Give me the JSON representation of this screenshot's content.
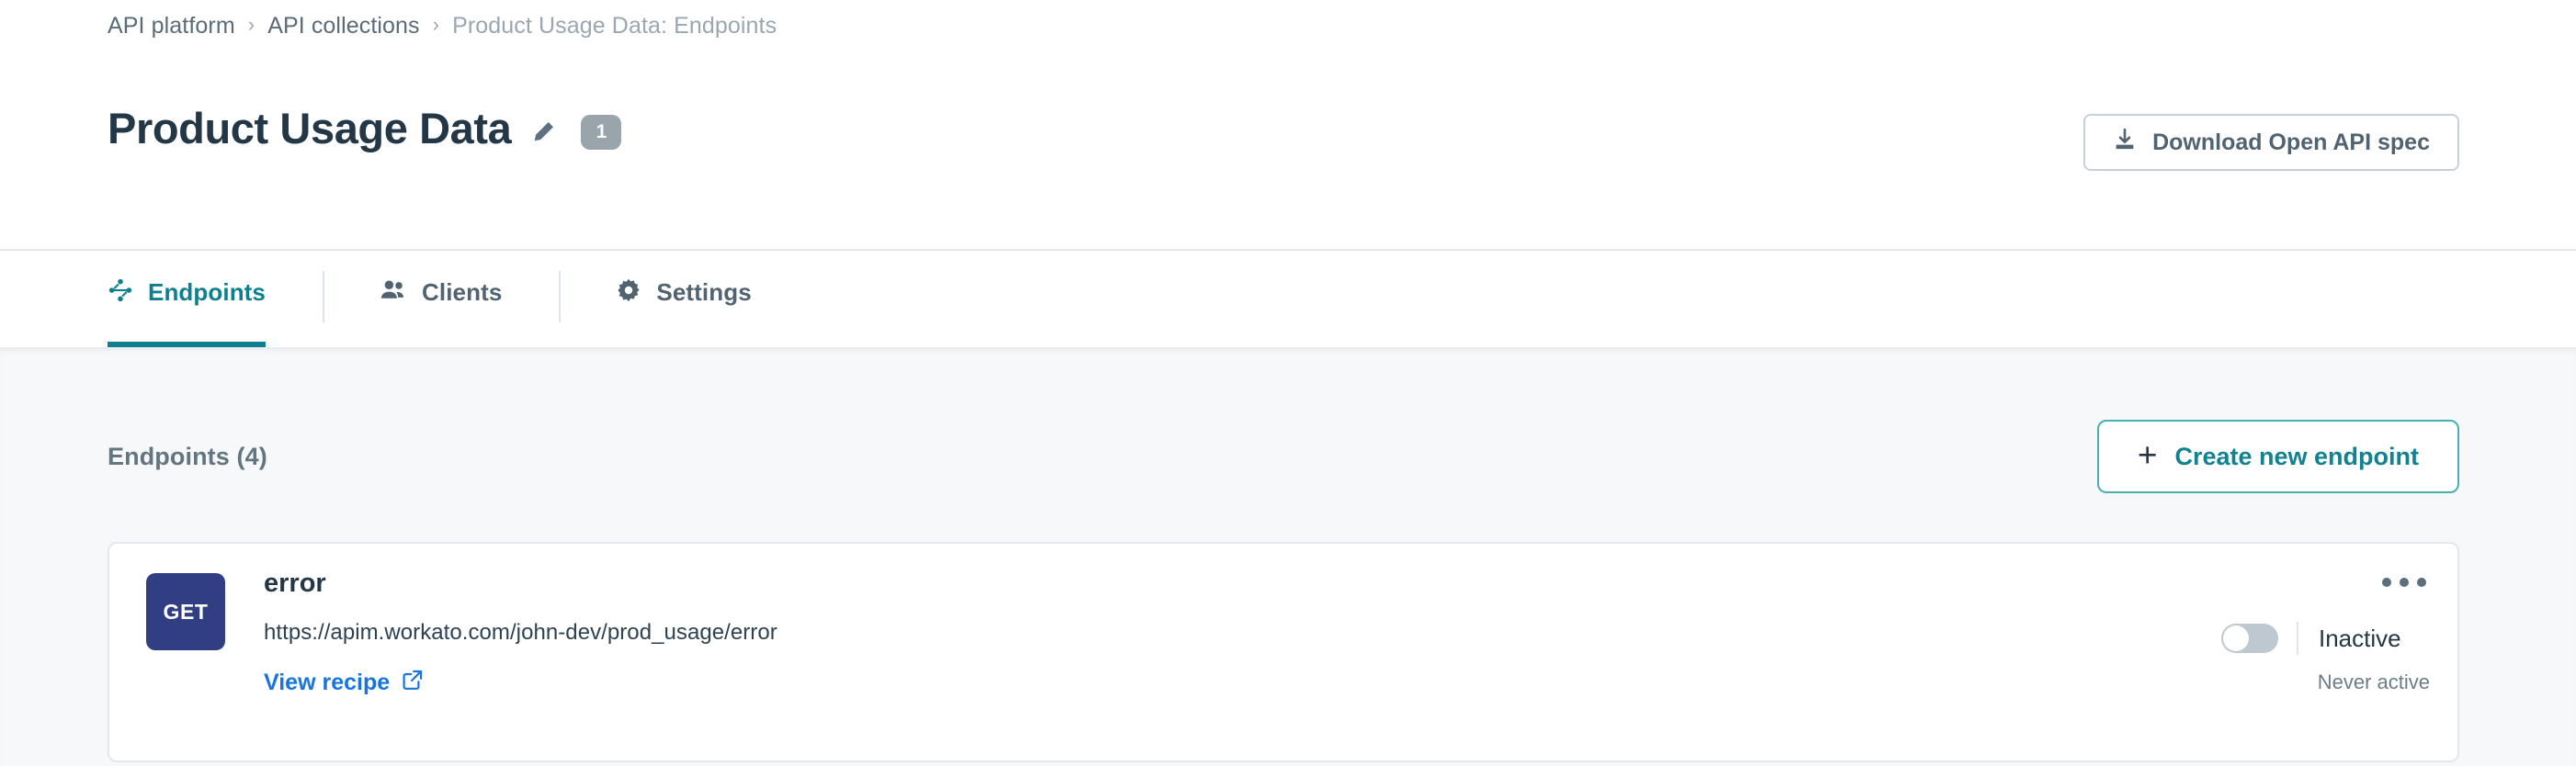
{
  "breadcrumb": {
    "items": [
      {
        "label": "API platform",
        "current": false
      },
      {
        "label": "API collections",
        "current": false
      },
      {
        "label": "Product Usage Data: Endpoints",
        "current": true
      }
    ],
    "separator": "›"
  },
  "header": {
    "title": "Product Usage Data",
    "edit_icon": "pencil-icon",
    "badge_count": "1",
    "download_button": {
      "label": "Download Open API spec",
      "icon": "download-icon"
    }
  },
  "tabs": [
    {
      "label": "Endpoints",
      "icon": "share-nodes-icon",
      "active": true
    },
    {
      "label": "Clients",
      "icon": "users-icon",
      "active": false
    },
    {
      "label": "Settings",
      "icon": "gear-icon",
      "active": false
    }
  ],
  "main": {
    "section_title": "Endpoints (4)",
    "create_button": {
      "label": "Create new endpoint",
      "icon": "plus-icon",
      "plus": "+"
    },
    "endpoints": [
      {
        "method": "GET",
        "name": "error",
        "url": "https://apim.workato.com/john-dev/prod_usage/error",
        "view_recipe_label": "View recipe",
        "view_recipe_icon": "external-link-icon",
        "menu_icon": "kebab-menu-icon",
        "toggle_on": false,
        "status": "Inactive",
        "last_active": "Never active"
      }
    ]
  },
  "colors": {
    "accent_teal": "#0d7f8e",
    "create_border": "#46b0b5",
    "method_badge": "#313e84",
    "link_blue": "#1874de",
    "text_dark": "#243746",
    "text_muted": "#63757f",
    "content_bg": "#f6f8f9",
    "badge_grey": "#9aa4ab"
  }
}
